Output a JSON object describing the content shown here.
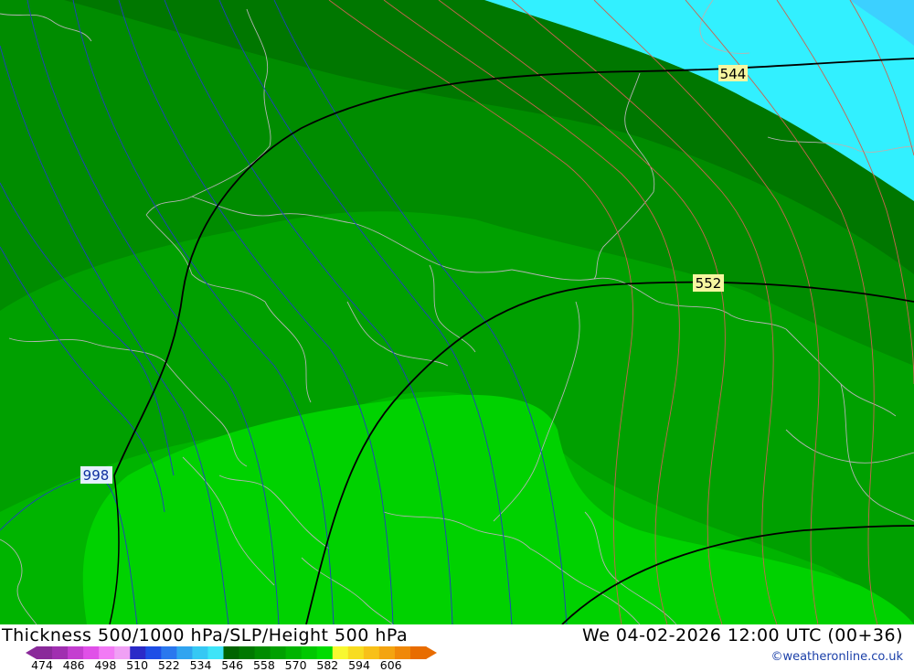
{
  "title": "Thickness 500/1000 hPa/SLP/Height 500 hPa",
  "valid_time": "We 04-02-2026 12:00 UTC (00+36)",
  "credit": "©weatheronline.co.uk",
  "contour_labels": {
    "height_544": "544",
    "height_552": "552",
    "slp_998": "998"
  },
  "legend": {
    "ticks": [
      "474",
      "486",
      "498",
      "510",
      "522",
      "534",
      "546",
      "558",
      "570",
      "582",
      "594",
      "606"
    ],
    "colors": [
      "#8a2a9a",
      "#a02fb0",
      "#c43ed0",
      "#e050e8",
      "#f27af5",
      "#f0a0f5",
      "#2a2ac8",
      "#1e4ee6",
      "#2a78ee",
      "#30a4f0",
      "#36c8f4",
      "#3ee4f8",
      "#006400",
      "#007800",
      "#008c00",
      "#00a000",
      "#00b400",
      "#00c800",
      "#00dc00",
      "#f8f830",
      "#f8dc20",
      "#f8c018",
      "#f4a410",
      "#f08808",
      "#e86c00"
    ],
    "colors_note": "legend palette"
  },
  "map_colors": {
    "cyan": "#32f0ff",
    "deep_green": "#007700",
    "dark_green": "#008c00",
    "mid_green": "#00a000",
    "green": "#00b400",
    "bright_green": "#00d200",
    "slp_isobar": "#2040c0",
    "thickness_isoline": "#c86450",
    "height_contour": "#000000",
    "borders": "#b4b4b4"
  }
}
